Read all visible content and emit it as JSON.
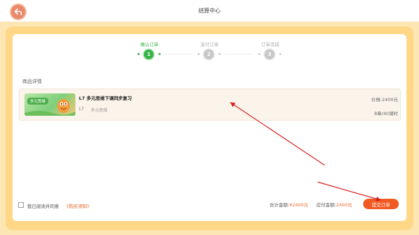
{
  "header": {
    "title": "结算中心",
    "back_icon": "back-arrow-icon"
  },
  "steps": [
    {
      "label": "确认订单",
      "number": "1",
      "active": true
    },
    {
      "label": "支付订单",
      "number": "2",
      "active": false
    },
    {
      "label": "订单完成",
      "number": "3",
      "active": false
    }
  ],
  "section": {
    "title": "商品详情"
  },
  "product": {
    "thumb_tag": "多元思维",
    "name": "L7 多元思维下课同步复习",
    "level": "L7",
    "type": "多元思维",
    "price": "价格:2400元",
    "chapters": "8章/40课时"
  },
  "footer": {
    "agree_text": "我已阅读并同意",
    "agree_link": "《购买须知》",
    "total_label": "合计金额:",
    "total_value": "¥2400元",
    "payable_label": "应付金额:",
    "payable_value": "2400元",
    "submit_label": "提交订单"
  },
  "colors": {
    "accent": "#f05a23",
    "step_active": "#38b44a",
    "annotation_arrow": "#d62020"
  }
}
